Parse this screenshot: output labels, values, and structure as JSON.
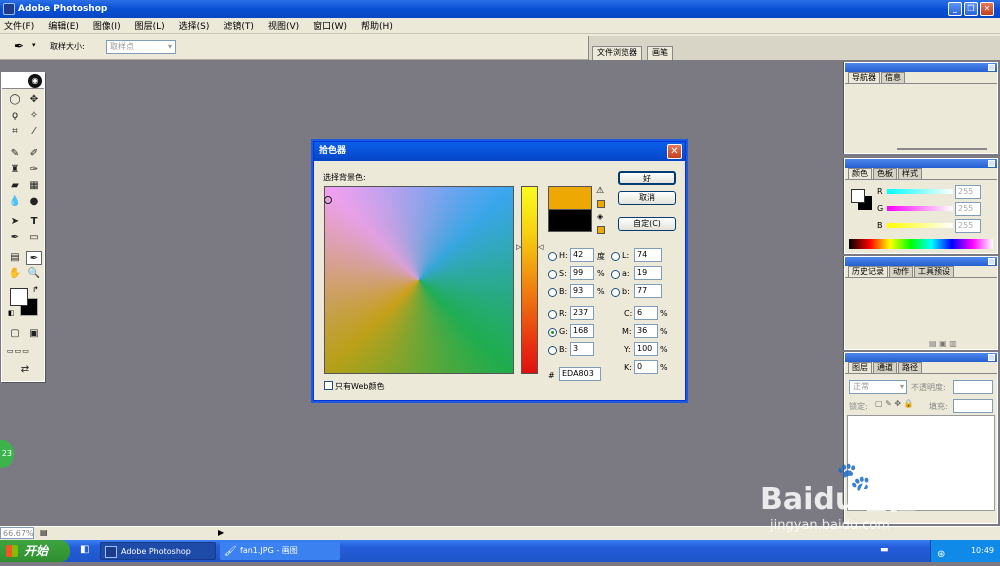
{
  "window": {
    "title": "Adobe Photoshop"
  },
  "menu": [
    "文件(F)",
    "编辑(E)",
    "图像(I)",
    "图层(L)",
    "选择(S)",
    "滤镜(T)",
    "视图(V)",
    "窗口(W)",
    "帮助(H)"
  ],
  "options": {
    "sample_size_label": "取样大小:",
    "sample_size_value": "取样点",
    "tabs": [
      "文件浏览器",
      "画笔"
    ]
  },
  "panels": {
    "navigator": {
      "tabs": [
        "导航器",
        "信息"
      ]
    },
    "color": {
      "tabs": [
        "颜色",
        "色板",
        "样式"
      ],
      "r_label": "R",
      "g_label": "G",
      "b_label": "B",
      "r": "255",
      "g": "255",
      "b": "255"
    },
    "history": {
      "tabs": [
        "历史记录",
        "动作",
        "工具预设"
      ]
    },
    "layers": {
      "tabs": [
        "图层",
        "通道",
        "路径"
      ],
      "blend_mode": "正常",
      "opacity_label": "不透明度:",
      "lock_label": "锁定:",
      "fill_label": "填充:"
    }
  },
  "dialog": {
    "title": "拾色器",
    "subtitle": "选择背景色:",
    "ok": "好",
    "cancel": "取消",
    "custom": "自定(C)",
    "web_only": "只有Web颜色",
    "hsb": {
      "h_label": "H:",
      "h": "42",
      "h_unit": "度",
      "s_label": "S:",
      "s": "99",
      "s_unit": "%",
      "b_label": "B:",
      "b": "93",
      "b_unit": "%"
    },
    "lab": {
      "l_label": "L:",
      "l": "74",
      "a_label": "a:",
      "a": "19",
      "b_label": "b:",
      "b": "77"
    },
    "rgb": {
      "r_label": "R:",
      "r": "237",
      "g_label": "G:",
      "g": "168",
      "b_label": "B:",
      "b": "3"
    },
    "cmyk": {
      "c_label": "C:",
      "c": "6",
      "m_label": "M:",
      "m": "36",
      "y_label": "Y:",
      "y": "100",
      "k_label": "K:",
      "k": "0",
      "unit": "%"
    },
    "hex_label": "#",
    "hex": "EDA803",
    "new_color": "#eda803",
    "old_color": "#000000"
  },
  "status": {
    "zoom": "66.67%"
  },
  "taskbar": {
    "start": "开始",
    "tasks": [
      "Adobe Photoshop",
      "fan1.JPG - 画图"
    ],
    "time": "10:49",
    "badge": "23"
  },
  "watermark": {
    "brand": "Baidu经验",
    "url": "jingyan.baidu.com"
  }
}
